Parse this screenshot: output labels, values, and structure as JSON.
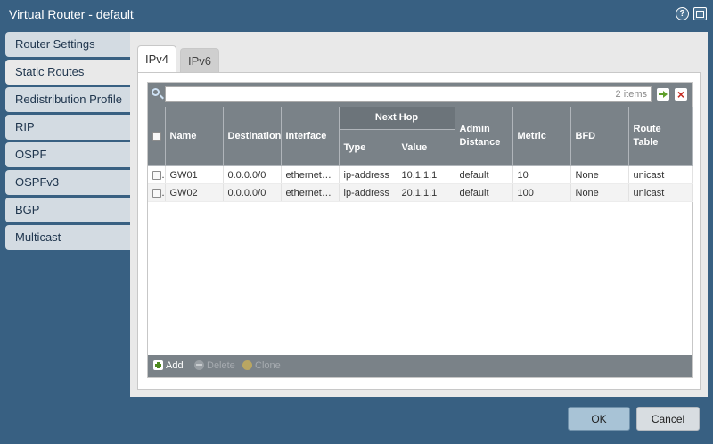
{
  "window": {
    "title": "Virtual Router - default"
  },
  "sidebar": {
    "items": [
      {
        "label": "Router Settings"
      },
      {
        "label": "Static Routes"
      },
      {
        "label": "Redistribution Profile"
      },
      {
        "label": "RIP"
      },
      {
        "label": "OSPF"
      },
      {
        "label": "OSPFv3"
      },
      {
        "label": "BGP"
      },
      {
        "label": "Multicast"
      }
    ],
    "active": "Static Routes"
  },
  "tabs": [
    {
      "label": "IPv4"
    },
    {
      "label": "IPv6"
    }
  ],
  "active_tab": "IPv4",
  "search": {
    "placeholder": "2 items"
  },
  "table": {
    "group_header": "Next Hop",
    "columns": {
      "name": "Name",
      "destination": "Destination",
      "interface": "Interface",
      "type": "Type",
      "value": "Value",
      "admin_distance": "Admin Distance",
      "metric": "Metric",
      "bfd": "BFD",
      "route_table": "Route Table"
    },
    "rows": [
      {
        "name": "GW01",
        "destination": "0.0.0.0/0",
        "interface": "ethernet…",
        "type": "ip-address",
        "value": "10.1.1.1",
        "admin_distance": "default",
        "metric": "10",
        "bfd": "None",
        "route_table": "unicast"
      },
      {
        "name": "GW02",
        "destination": "0.0.0.0/0",
        "interface": "ethernet…",
        "type": "ip-address",
        "value": "20.1.1.1",
        "admin_distance": "default",
        "metric": "100",
        "bfd": "None",
        "route_table": "unicast"
      }
    ]
  },
  "footer": {
    "add": "Add",
    "delete": "Delete",
    "clone": "Clone"
  },
  "dialog": {
    "ok": "OK",
    "cancel": "Cancel"
  }
}
